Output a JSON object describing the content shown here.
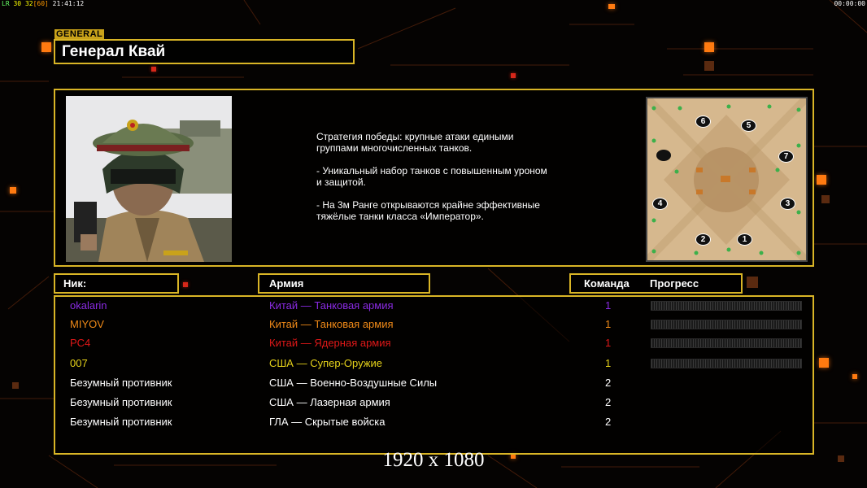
{
  "status": {
    "left_prefix": "LR",
    "left_fps": "30",
    "left_frames": "32",
    "left_limit": "[60]",
    "left_time": "21:41:12",
    "right_timer": "00:00:00"
  },
  "general": {
    "tag": "GENERAL",
    "name": "Генерал Квай"
  },
  "description": "Стратегия победы: крупные атаки едиными\n группами многочисленных танков.\n\n- Уникальный набор танков с повышенным уроном\n и защитой.\n\n- На 3м Ранге открываются крайне эффективные\n тяжёлые танки класса «Император».",
  "map": {
    "slots": [
      "1",
      "2",
      "3",
      "4",
      "5",
      "6",
      "7"
    ]
  },
  "table": {
    "headers": {
      "nick": "Ник:",
      "army": "Армия",
      "team": "Команда",
      "progress": "Прогресс"
    },
    "rows": [
      {
        "nick": "okalarin",
        "army": "Китай — Танковая армия",
        "team": "1",
        "color": "#8a2be2",
        "progress": 0
      },
      {
        "nick": "MIYOV",
        "army": "Китай — Танковая армия",
        "team": "1",
        "color": "#f08a18",
        "progress": 0
      },
      {
        "nick": "PC4",
        "army": "Китай — Ядерная армия",
        "team": "1",
        "color": "#e01818",
        "progress": 0
      },
      {
        "nick": "007",
        "army": "США — Супер-Оружие",
        "team": "1",
        "color": "#e6d21a",
        "progress": 0
      },
      {
        "nick": "Безумный противник",
        "army": "США — Военно-Воздушные Силы",
        "team": "2",
        "color": "#ffffff"
      },
      {
        "nick": "Безумный противник",
        "army": "США — Лазерная армия",
        "team": "2",
        "color": "#ffffff"
      },
      {
        "nick": "Безумный противник",
        "army": "ГЛА — Скрытые войска",
        "team": "2",
        "color": "#ffffff"
      }
    ]
  },
  "resolution": "1920 x 1080",
  "colors": {
    "accent_border": "#d9b526",
    "deco_orange": "#ff7a10"
  }
}
